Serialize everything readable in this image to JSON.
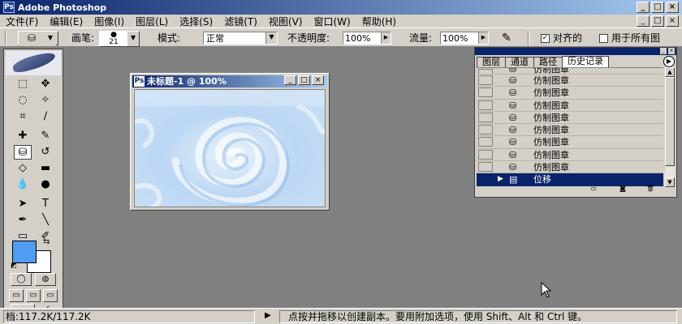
{
  "app": {
    "title": "Adobe Photoshop"
  },
  "menu": {
    "items": [
      "文件(F)",
      "编辑(E)",
      "图像(I)",
      "图层(L)",
      "选择(S)",
      "滤镜(T)",
      "视图(V)",
      "窗口(W)",
      "帮助(H)"
    ]
  },
  "window_controls": {
    "minimize": "_",
    "maximize": "□",
    "close": "×"
  },
  "options": {
    "brush_label": "画笔:",
    "brush_size": "21",
    "mode_label": "模式:",
    "mode_value": "正常",
    "opacity_label": "不透明度:",
    "opacity_value": "100%",
    "flow_label": "流量:",
    "flow_value": "100%",
    "aligned_label": "对齐的",
    "aligned_checked": true,
    "all_layers_label": "用于所有图",
    "all_layers_checked": false
  },
  "document": {
    "title": "未标题-1 @ 100%",
    "canvas_colors": [
      "#c9dff5",
      "#a9cbef",
      "#eaf3fc"
    ]
  },
  "history_panel": {
    "tabs": [
      "图层",
      "通道",
      "路径",
      "历史记录"
    ],
    "active_tab": "历史记录",
    "rows": [
      {
        "label": "仿制图章",
        "selected": false,
        "partial": true
      },
      {
        "label": "仿制图章",
        "selected": false
      },
      {
        "label": "仿制图章",
        "selected": false
      },
      {
        "label": "仿制图章",
        "selected": false
      },
      {
        "label": "仿制图章",
        "selected": false
      },
      {
        "label": "仿制图章",
        "selected": false
      },
      {
        "label": "仿制图章",
        "selected": false
      },
      {
        "label": "仿制图章",
        "selected": false
      },
      {
        "label": "仿制图章",
        "selected": false
      },
      {
        "label": "位移",
        "selected": true
      }
    ]
  },
  "toolbox": {
    "foreground_color": "#4f9df0",
    "background_color": "#ffffff"
  },
  "status": {
    "doc_info": "档:117.2K/117.2K",
    "message": "点按并拖移以创建副本。要用附加选项，使用 Shift、Alt 和 Ctrl 键。"
  },
  "colors": {
    "titlebar_start": "#0a246a",
    "titlebar_end": "#a6caf0",
    "chrome": "#d4d0c8",
    "workspace": "#808080"
  }
}
